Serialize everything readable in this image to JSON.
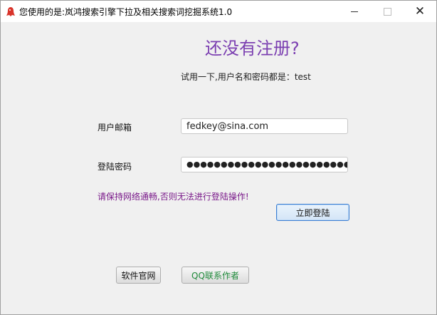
{
  "window": {
    "title": "您使用的是:岚鸿搜索引擎下拉及相关搜索词挖掘系统1.0",
    "minimize": "—",
    "maximize": "□",
    "close": "✕"
  },
  "form": {
    "heading": "还没有注册?",
    "hint": "试用一下,用户名和密码都是：test",
    "email_label": "用户邮箱",
    "email_value": "fedkey@sina.com",
    "password_label": "登陆密码",
    "password_mask": "●●●●●●●●●●●●●●●●●●●●●●●●●●●●●●●●●●●●●●●●",
    "warning": "请保持网络通畅,否则无法进行登陆操作!",
    "login_button": "立即登陆"
  },
  "footer": {
    "software_button": "软件官网",
    "qq_button": "QQ联系作者"
  },
  "colors": {
    "heading": "#7b3fb1",
    "warning": "#7a1a8a",
    "qq_text": "#1f8a3a",
    "login_border": "#3d7fd3"
  },
  "icons": {
    "app": "red-bird-icon"
  }
}
